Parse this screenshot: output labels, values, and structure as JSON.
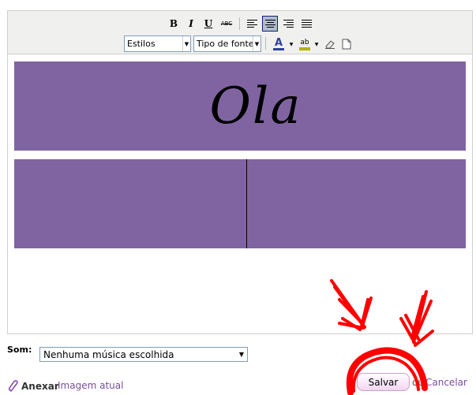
{
  "toolbar": {
    "bold": "B",
    "italic": "I",
    "underline": "U",
    "strike": "ABC",
    "styles_select": "Estilos",
    "font_select": "Tipo de fonte",
    "font_color_glyph": "A",
    "highlight_glyph": "ab",
    "active_alignment": "center"
  },
  "content": {
    "banner_text": "Ola"
  },
  "sound": {
    "label": "Som:",
    "selected": "Nenhuma música escolhida"
  },
  "footer": {
    "attach_label": "Anexar",
    "current_image_link": "Imagem atual",
    "save_button": "Salvar",
    "or_text": "ou",
    "cancel_link": "Cancelar"
  },
  "colors": {
    "banner_bg": "#8064a2",
    "toolbar_bg": "#f0f0ee",
    "link": "#7b4d9e",
    "scribble": "#ff0000"
  }
}
